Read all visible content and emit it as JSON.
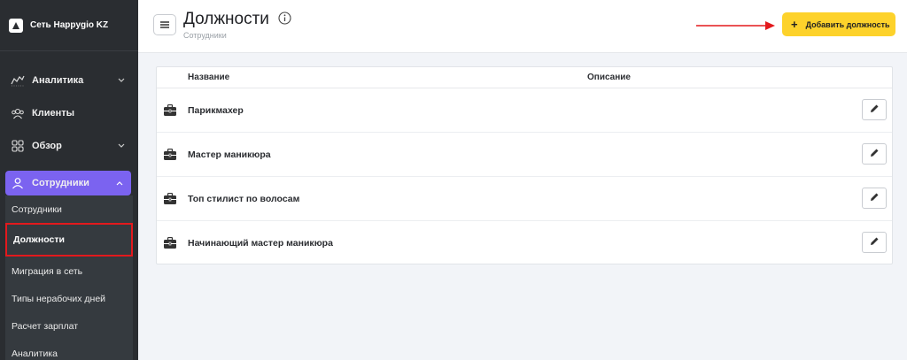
{
  "brand": {
    "name": "Сеть Happygio KZ"
  },
  "nav": [
    {
      "label": "Аналитика",
      "icon": "analytics-icon",
      "has_chevron": true
    },
    {
      "label": "Клиенты",
      "icon": "clients-icon",
      "has_chevron": false
    },
    {
      "label": "Обзор",
      "icon": "grid-icon",
      "has_chevron": true
    }
  ],
  "active_section": {
    "label": "Сотрудники",
    "icon": "user-icon"
  },
  "submenu": [
    "Сотрудники",
    "Должности",
    "Миграция в сеть",
    "Типы нерабочих дней",
    "Расчет зарплат",
    "Аналитика"
  ],
  "header": {
    "title": "Должности",
    "breadcrumb": "Сотрудники",
    "add_button": "Добавить должность",
    "add_plus": "+"
  },
  "table": {
    "columns": [
      "Название",
      "Описание"
    ],
    "rows": [
      {
        "name": "Парикмахер",
        "description": ""
      },
      {
        "name": "Мастер маникюра",
        "description": ""
      },
      {
        "name": "Топ стилист по волосам",
        "description": ""
      },
      {
        "name": "Начинающий мастер маникюра",
        "description": ""
      }
    ]
  },
  "colors": {
    "sidebar": "#2a2d31",
    "active": "#7b63f0",
    "accent": "#fdd22b",
    "highlight": "#e3191d"
  }
}
